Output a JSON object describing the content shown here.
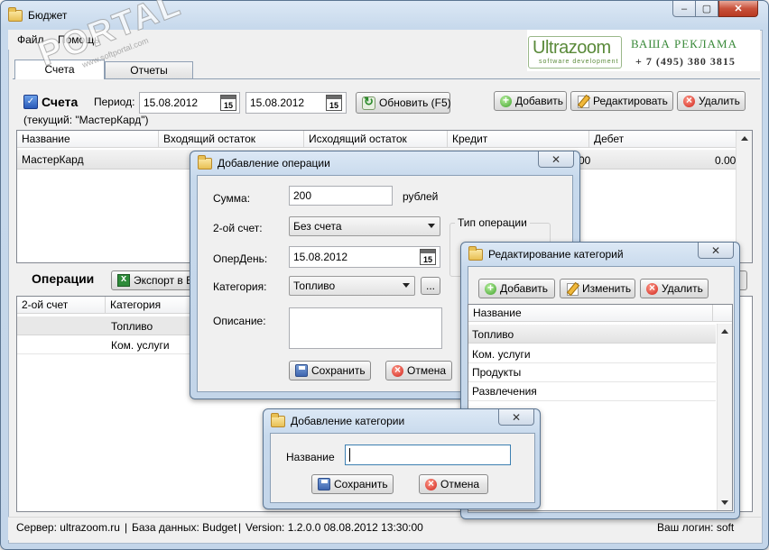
{
  "window": {
    "title": "Бюджет"
  },
  "menu": {
    "file": "Файл",
    "help": "Помощь"
  },
  "ad": {
    "logo_main": "Ultrazoom",
    "logo_sub": "software development",
    "text": "ВАША РЕКЛАМА",
    "phone": "+ 7 (495) 380 3815"
  },
  "watermark": {
    "text": "PORTAL",
    "url": "www.softportal.com",
    "tm": "TM"
  },
  "tabs": [
    "Счета",
    "Отчеты"
  ],
  "accounts": {
    "title": "Счета",
    "period_label": "Период:",
    "date_from": "15.08.2012",
    "date_to": "15.08.2012",
    "calendar_day": "15",
    "refresh_label": "Обновить (F5)",
    "add_label": "Добавить",
    "edit_label": "Редактировать",
    "delete_label": "Удалить",
    "current": "(текущий: \"МастерКард\")",
    "columns": [
      "Название",
      "Входящий остаток",
      "Исходящий остаток",
      "Кредит",
      "Дебет"
    ],
    "rows": [
      {
        "name": "МастерКард",
        "credit_visible": "00",
        "debit": "0.00"
      }
    ]
  },
  "operations": {
    "title": "Операции",
    "export_label": "Экспорт в E",
    "columns": [
      "2-ой счет",
      "Категория"
    ],
    "rows": [
      {
        "category": "Топливо"
      },
      {
        "category": "Ком. услуги"
      }
    ]
  },
  "status": {
    "server": "Сервер: ultrazoom.ru",
    "db": "База данных: Budget",
    "version": "Version: 1.2.0.0 08.08.2012 13:30:00",
    "login": "Ваш логин: soft"
  },
  "add_operation": {
    "title": "Добавление операции",
    "sum_label": "Сумма:",
    "sum_value": "200",
    "currency": "рублей",
    "account2_label": "2-ой счет:",
    "account2_value": "Без счета",
    "op_type_label": "Тип операции",
    "opday_label": "ОперДень:",
    "opday_value": "15.08.2012",
    "category_label": "Категория:",
    "category_value": "Топливо",
    "browse_label": "...",
    "desc_label": "Описание:",
    "save_label": "Сохранить",
    "cancel_label": "Отмена"
  },
  "edit_categories": {
    "title": "Редактирование категорий",
    "add_label": "Добавить",
    "edit_label": "Изменить",
    "delete_label": "Удалить",
    "column": "Название",
    "items": [
      "Топливо",
      "Ком. услуги",
      "Продукты",
      "Развлечения"
    ]
  },
  "add_category": {
    "title": "Добавление категории",
    "name_label": "Название",
    "name_value": "",
    "save_label": "Сохранить",
    "cancel_label": "Отмена"
  }
}
